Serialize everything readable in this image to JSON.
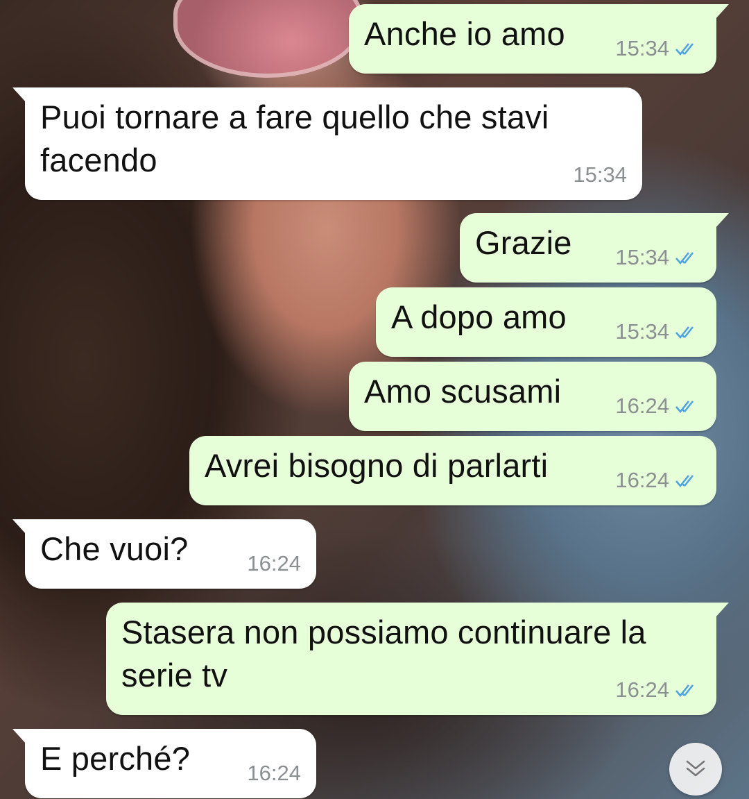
{
  "messages": [
    {
      "direction": "out",
      "text": "Anche io amo",
      "time": "15:34",
      "status": "read"
    },
    {
      "direction": "in",
      "text": "Puoi tornare a fare quello che stavi facendo",
      "time": "15:34"
    },
    {
      "direction": "out",
      "text": "Grazie",
      "time": "15:34",
      "status": "read"
    },
    {
      "direction": "out",
      "text": "A dopo amo",
      "time": "15:34",
      "status": "read"
    },
    {
      "direction": "out",
      "text": "Amo scusami",
      "time": "16:24",
      "status": "read"
    },
    {
      "direction": "out",
      "text": "Avrei bisogno di parlarti",
      "time": "16:24",
      "status": "read"
    },
    {
      "direction": "in",
      "text": "Che vuoi?",
      "time": "16:24"
    },
    {
      "direction": "out",
      "text": "Stasera non possiamo continuare la serie tv",
      "time": "16:24",
      "status": "read"
    },
    {
      "direction": "in",
      "text": "E perché?",
      "time": "16:24"
    }
  ],
  "colors": {
    "outgoing_bubble": "#e6ffd8",
    "incoming_bubble": "#ffffff",
    "read_ticks": "#4fa3e0",
    "timestamp": "#8a8f92"
  },
  "icons": {
    "read_receipt": "double-check-icon",
    "scroll_down": "chevron-down-double-icon"
  }
}
